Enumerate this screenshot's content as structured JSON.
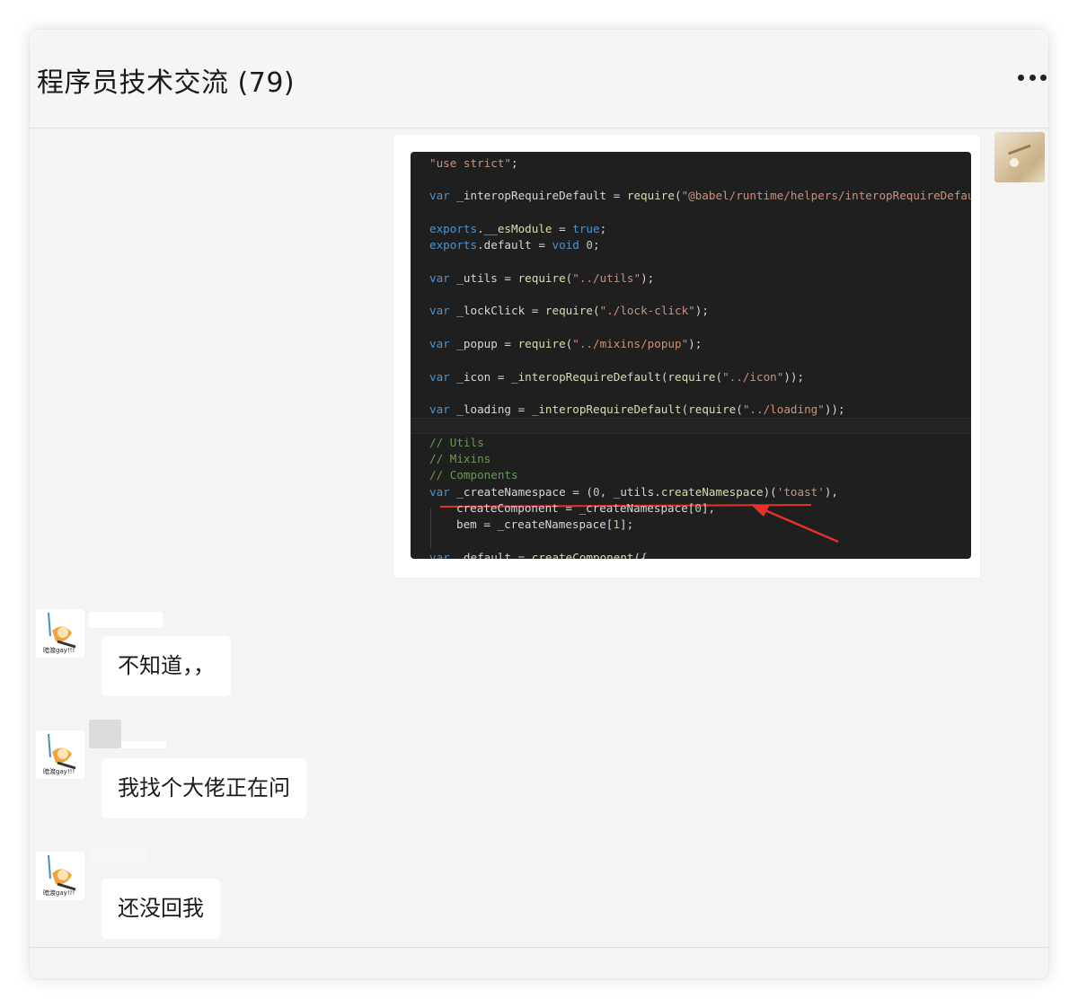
{
  "header": {
    "title": "程序员技术交流 (79)",
    "more_icon": "more-dots-icon"
  },
  "image_message": {
    "code_lines": [
      {
        "seg": [
          [
            "str",
            "\"use strict\""
          ],
          [
            "",
            ";"
          ]
        ]
      },
      {
        "seg": [
          [
            "kw",
            "var"
          ],
          [
            "",
            " _interopRequireDefault = "
          ],
          [
            "fn",
            "require"
          ],
          [
            "",
            "("
          ],
          [
            "str",
            "\"@babel/runtime/helpers/interopRequireDefault\""
          ]
        ]
      },
      {
        "seg": [
          [
            "kw",
            "exports"
          ],
          [
            "",
            "."
          ],
          [
            "fn",
            "__esModule"
          ],
          [
            "",
            " = "
          ],
          [
            "kw",
            "true"
          ],
          [
            "",
            ";"
          ]
        ]
      },
      {
        "seg": [
          [
            "kw",
            "exports"
          ],
          [
            "",
            ".default = "
          ],
          [
            "kw",
            "void"
          ],
          [
            "",
            " "
          ],
          [
            "num",
            "0"
          ],
          [
            "",
            ";"
          ]
        ]
      },
      {
        "seg": [
          [
            "kw",
            "var"
          ],
          [
            "",
            " _utils = "
          ],
          [
            "fn",
            "require"
          ],
          [
            "",
            "("
          ],
          [
            "str",
            "\"../utils\""
          ],
          [
            "",
            ");"
          ]
        ]
      },
      {
        "seg": [
          [
            "kw",
            "var"
          ],
          [
            "",
            " _lockClick = "
          ],
          [
            "fn",
            "require"
          ],
          [
            "",
            "("
          ],
          [
            "str",
            "\"./lock-click\""
          ],
          [
            "",
            ");"
          ]
        ]
      },
      {
        "seg": [
          [
            "kw",
            "var"
          ],
          [
            "",
            " _popup = "
          ],
          [
            "fn",
            "require"
          ],
          [
            "",
            "("
          ],
          [
            "str",
            "\"../mixins/popup\""
          ],
          [
            "",
            ");"
          ]
        ]
      },
      {
        "seg": [
          [
            "kw",
            "var"
          ],
          [
            "",
            " _icon = "
          ],
          [
            "fn",
            "_interopRequireDefault"
          ],
          [
            "",
            "("
          ],
          [
            "fn",
            "require"
          ],
          [
            "",
            "("
          ],
          [
            "str",
            "\"../icon\""
          ],
          [
            "",
            "));"
          ]
        ]
      },
      {
        "seg": [
          [
            "kw",
            "var"
          ],
          [
            "",
            " _loading = "
          ],
          [
            "fn",
            "_interopRequireDefault"
          ],
          [
            "",
            "("
          ],
          [
            "fn",
            "require"
          ],
          [
            "",
            "("
          ],
          [
            "str",
            "\"../loading\""
          ],
          [
            "",
            "));"
          ]
        ]
      },
      {
        "seg": [
          [
            "cmt",
            "// Utils"
          ]
        ]
      },
      {
        "seg": [
          [
            "cmt",
            "// Mixins"
          ]
        ]
      },
      {
        "seg": [
          [
            "cmt",
            "// Components"
          ]
        ]
      },
      {
        "seg": [
          [
            "kw",
            "var"
          ],
          [
            "",
            " _createNamespace = ("
          ],
          [
            "num",
            "0"
          ],
          [
            "",
            ", _utils."
          ],
          [
            "fn",
            "createNamespace"
          ],
          [
            "",
            ")("
          ],
          [
            "str",
            "'toast'"
          ],
          [
            "",
            "),"
          ]
        ]
      },
      {
        "seg": [
          [
            "",
            "createComponent = _createNamespace["
          ],
          [
            "num",
            "0"
          ],
          [
            "",
            "],"
          ]
        ]
      },
      {
        "seg": [
          [
            "",
            "bem = _createNamespace["
          ],
          [
            "num",
            "1"
          ],
          [
            "",
            "];"
          ]
        ]
      },
      {
        "seg": [
          [
            "kw",
            "var"
          ],
          [
            "",
            " _default = "
          ],
          [
            "fn",
            "createComponent"
          ],
          [
            "",
            "({"
          ]
        ]
      }
    ],
    "annotation_color": "#e8302a"
  },
  "messages": [
    {
      "text": "不知道，，",
      "caption": "暗渡gay!!!"
    },
    {
      "text": "我找个大佬正在问",
      "caption": "暗渡gay!!!"
    },
    {
      "text": "还没回我",
      "caption": "暗渡gay!!!"
    }
  ]
}
